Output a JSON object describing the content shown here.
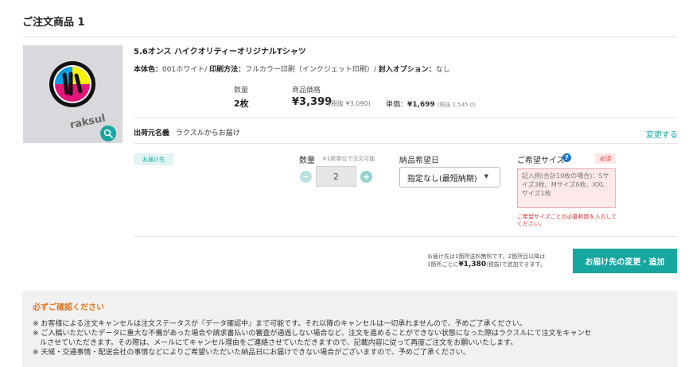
{
  "section": {
    "title": "ご注文商品 1"
  },
  "product": {
    "image_alt": "raksul",
    "name": "5.6オンス ハイクオリティーオリジナルTシャツ",
    "specs": [
      {
        "label": "本体色：",
        "value": "001ホワイト/ "
      },
      {
        "label": "印刷方法：",
        "value": "フルカラー印刷（インクジェット印刷）/ "
      },
      {
        "label": "封入オプション：",
        "value": "なし"
      }
    ],
    "qty_label": "数量",
    "qty_value": "2枚",
    "price_label": "商品価格",
    "price_value": "¥3,399",
    "price_tax": "(税抜 ¥3,090)",
    "unit_label": "単価：",
    "unit_value": "¥1,699",
    "unit_tax": "(税抜 1,545.0)"
  },
  "shipping": {
    "origin_label": "出荷元名義",
    "origin_value": "ラクスルからお届け",
    "change_link": "変更する"
  },
  "destination": {
    "badge": "お届け先",
    "qty_label": "数量",
    "qty_note": "※1枚単位で注文可能",
    "qty_value": "2",
    "date_label": "納品希望日",
    "date_selected": "指定なし(最短納期)",
    "size_label": "ご希望サイズ",
    "required": "必須",
    "size_placeholder": "記入例(合計10枚の場合)：Sサイズ3枚、Mサイズ6枚、XXLサイズ1枚",
    "size_error": "ご希望サイズごとの必要枚数を入力してください。"
  },
  "address": {
    "note_line1": "お届け先は1箇所送料無料です。2箇所目以降は",
    "note_prefix": "1箇所ごとに",
    "note_price": "¥1,380",
    "note_suffix": "(税抜)で追加できます。",
    "button": "お届け先の変更・追加"
  },
  "notice": {
    "title": "必ずご確認ください",
    "lines": [
      "※ お客様による注文キャンセルは注文ステータスが『データ確認中』まで可能です。それ以降のキャンセルは一切承れませんので、予めご了承ください。",
      "※ ご入稿いただいたデータに重大な不備があった場合や請求書払いの審査が通過しない場合など、注文を進めることができない状態になった際はラクスルにて注文をキャンセ",
      "　ルさせていただきます。その際は、メールにてキャンセル理由をご連絡させていただきますので、記載内容に従って再度ご注文をお願いいたします。",
      "※ 天候・交通事情・配送会社の事情などによりご希望いただいた納品日にお届けできない場合がございますので、予めご了承ください。"
    ]
  },
  "colors": {
    "accent": "#17a6a0",
    "notice_title": "#e2771c",
    "required": "#dd3333"
  }
}
